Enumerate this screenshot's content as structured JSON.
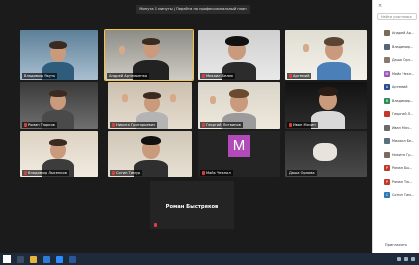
{
  "banner": {
    "text": "Минута 1 минуты | Перейти на профессиональный план"
  },
  "speaker": {
    "name": "Роман Быстряков"
  },
  "tiles": [
    {
      "label": "Владимир Якуть"
    },
    {
      "label": "Андрей Артемьенко"
    },
    {
      "label": "Михаил Белик"
    },
    {
      "label": "Артемий"
    },
    {
      "label": "Роман Тюрков"
    },
    {
      "label": "Никита Григорьевич"
    },
    {
      "label": "Георгий Литвинов"
    },
    {
      "label": "Иван Мячин"
    },
    {
      "label": "Владимир Лысенков"
    },
    {
      "label": "Сотин Тимур"
    },
    {
      "label": "Майк Чекпол"
    },
    {
      "label": "Даша Орлова"
    }
  ],
  "avatar_letter": "M",
  "panel": {
    "search_placeholder": "Найти участника",
    "participants": [
      {
        "letter": "",
        "name": "Андрей Ар..."
      },
      {
        "letter": "",
        "name": "Владимир..."
      },
      {
        "letter": "",
        "name": "Даша Орл..."
      },
      {
        "letter": "M",
        "name": "Майк Чекп..."
      },
      {
        "letter": "A",
        "name": "Артемий"
      },
      {
        "letter": "B",
        "name": "Владимир..."
      },
      {
        "letter": "",
        "name": "Георгий Л..."
      },
      {
        "letter": "",
        "name": "Иван Мяч..."
      },
      {
        "letter": "",
        "name": "Михаил Бе..."
      },
      {
        "letter": "",
        "name": "Никита Гр..."
      },
      {
        "letter": "P",
        "name": "Роман Бы..."
      },
      {
        "letter": "P",
        "name": "Роман Тю..."
      },
      {
        "letter": "C",
        "name": "Сотин Тим..."
      }
    ],
    "invite_label": "Пригласить"
  },
  "colors": {
    "active_outline": "#f6c342",
    "panel_avatars": [
      "#7a6b5c",
      "#556577",
      "#8a7a6a",
      "#9b59b6",
      "#2b4a8c",
      "#2e8b57",
      "#c0392b",
      "#6b6b6b",
      "#5c6e7a",
      "#7b6a5d",
      "#c0392b",
      "#c0392b",
      "#2a7ab8"
    ]
  }
}
